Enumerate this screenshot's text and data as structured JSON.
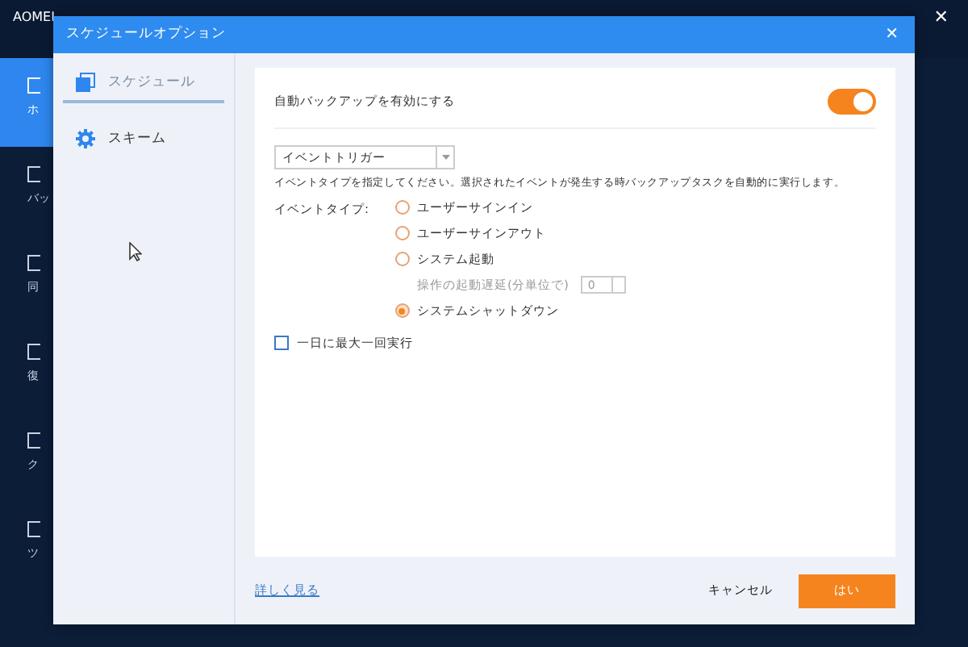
{
  "app": {
    "title": "AOMEI",
    "close": "✕",
    "sidebar": [
      {
        "label": "ホ",
        "selected": true
      },
      {
        "label": "バッ",
        "selected": false
      },
      {
        "label": "同",
        "selected": false
      },
      {
        "label": "復",
        "selected": false
      },
      {
        "label": "ク",
        "selected": false
      },
      {
        "label": "ツ",
        "selected": false
      }
    ]
  },
  "dialog": {
    "title": "スケジュールオプション",
    "close": "✕",
    "nav": [
      {
        "label": "スケジュール",
        "selected": true,
        "kind": "schedule"
      },
      {
        "label": "スキーム",
        "selected": false,
        "kind": "scheme"
      }
    ],
    "enable": {
      "label": "自動バックアップを有効にする",
      "on": true
    },
    "trigger": {
      "value": "イベントトリガー"
    },
    "description": "イベントタイプを指定してください。選択されたイベントが発生する時バックアップタスクを自動的に実行します。",
    "event_type_label": "イベントタイプ:",
    "options": [
      {
        "label": "ユーザーサインイン",
        "selected": false
      },
      {
        "label": "ユーザーサインアウト",
        "selected": false
      },
      {
        "label": "システム起動",
        "selected": false,
        "delay": {
          "label": "操作の起動遅延(分単位で)",
          "value": "0",
          "disabled": true
        }
      },
      {
        "label": "システムシャットダウン",
        "selected": true
      }
    ],
    "once_a_day": {
      "label": "一日に最大一回実行",
      "checked": false
    },
    "more_link": "詳しく見る",
    "buttons": [
      {
        "label": "キャンセル",
        "kind": "secondary"
      },
      {
        "label": "はい",
        "kind": "primary"
      }
    ]
  }
}
